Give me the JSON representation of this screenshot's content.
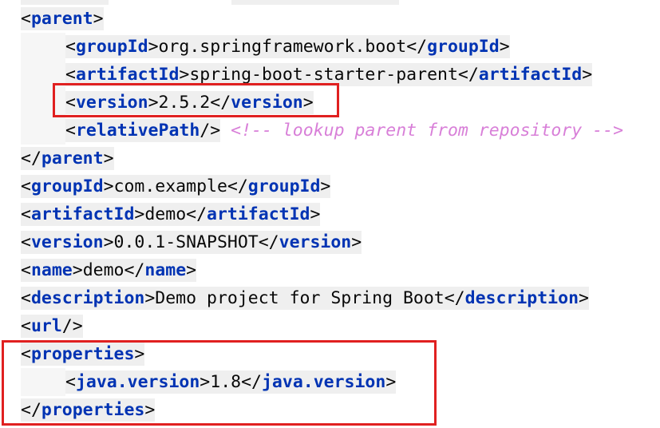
{
  "code_lines": [
    {
      "indent": 0,
      "open": "parent",
      "text": "",
      "close": ""
    },
    {
      "indent": 1,
      "open": "groupId",
      "text": "org.springframework.boot",
      "close": "groupId"
    },
    {
      "indent": 1,
      "open": "artifactId",
      "text": "spring-boot-starter-parent",
      "close": "artifactId"
    },
    {
      "indent": 1,
      "open": "version",
      "text": "2.5.2",
      "close": "version"
    },
    {
      "indent": 1,
      "selfclose": "relativePath",
      "comment": "<!-- lookup parent from repository -->"
    },
    {
      "indent": 0,
      "closeonly": "parent"
    },
    {
      "indent": 0,
      "open": "groupId",
      "text": "com.example",
      "close": "groupId"
    },
    {
      "indent": 0,
      "open": "artifactId",
      "text": "demo",
      "close": "artifactId"
    },
    {
      "indent": 0,
      "open": "version",
      "text": "0.0.1-SNAPSHOT",
      "close": "version"
    },
    {
      "indent": 0,
      "open": "name",
      "text": "demo",
      "close": "name"
    },
    {
      "indent": 0,
      "open": "description",
      "text": "Demo project for Spring Boot",
      "close": "description"
    },
    {
      "indent": 0,
      "selfclose": "url"
    },
    {
      "indent": 0,
      "open": "properties",
      "text": "",
      "close": ""
    },
    {
      "indent": 1,
      "open": "java.version",
      "text": "1.8",
      "close": "java.version"
    },
    {
      "indent": 0,
      "closeonly": "properties"
    }
  ],
  "highlights": {
    "highlight_color": "#e02020",
    "boxes": [
      "version line",
      "properties block"
    ]
  },
  "colors": {
    "tag": "#0033b3",
    "comment": "#d87fd8",
    "text": "#080808",
    "tag_background": "#efefef"
  }
}
